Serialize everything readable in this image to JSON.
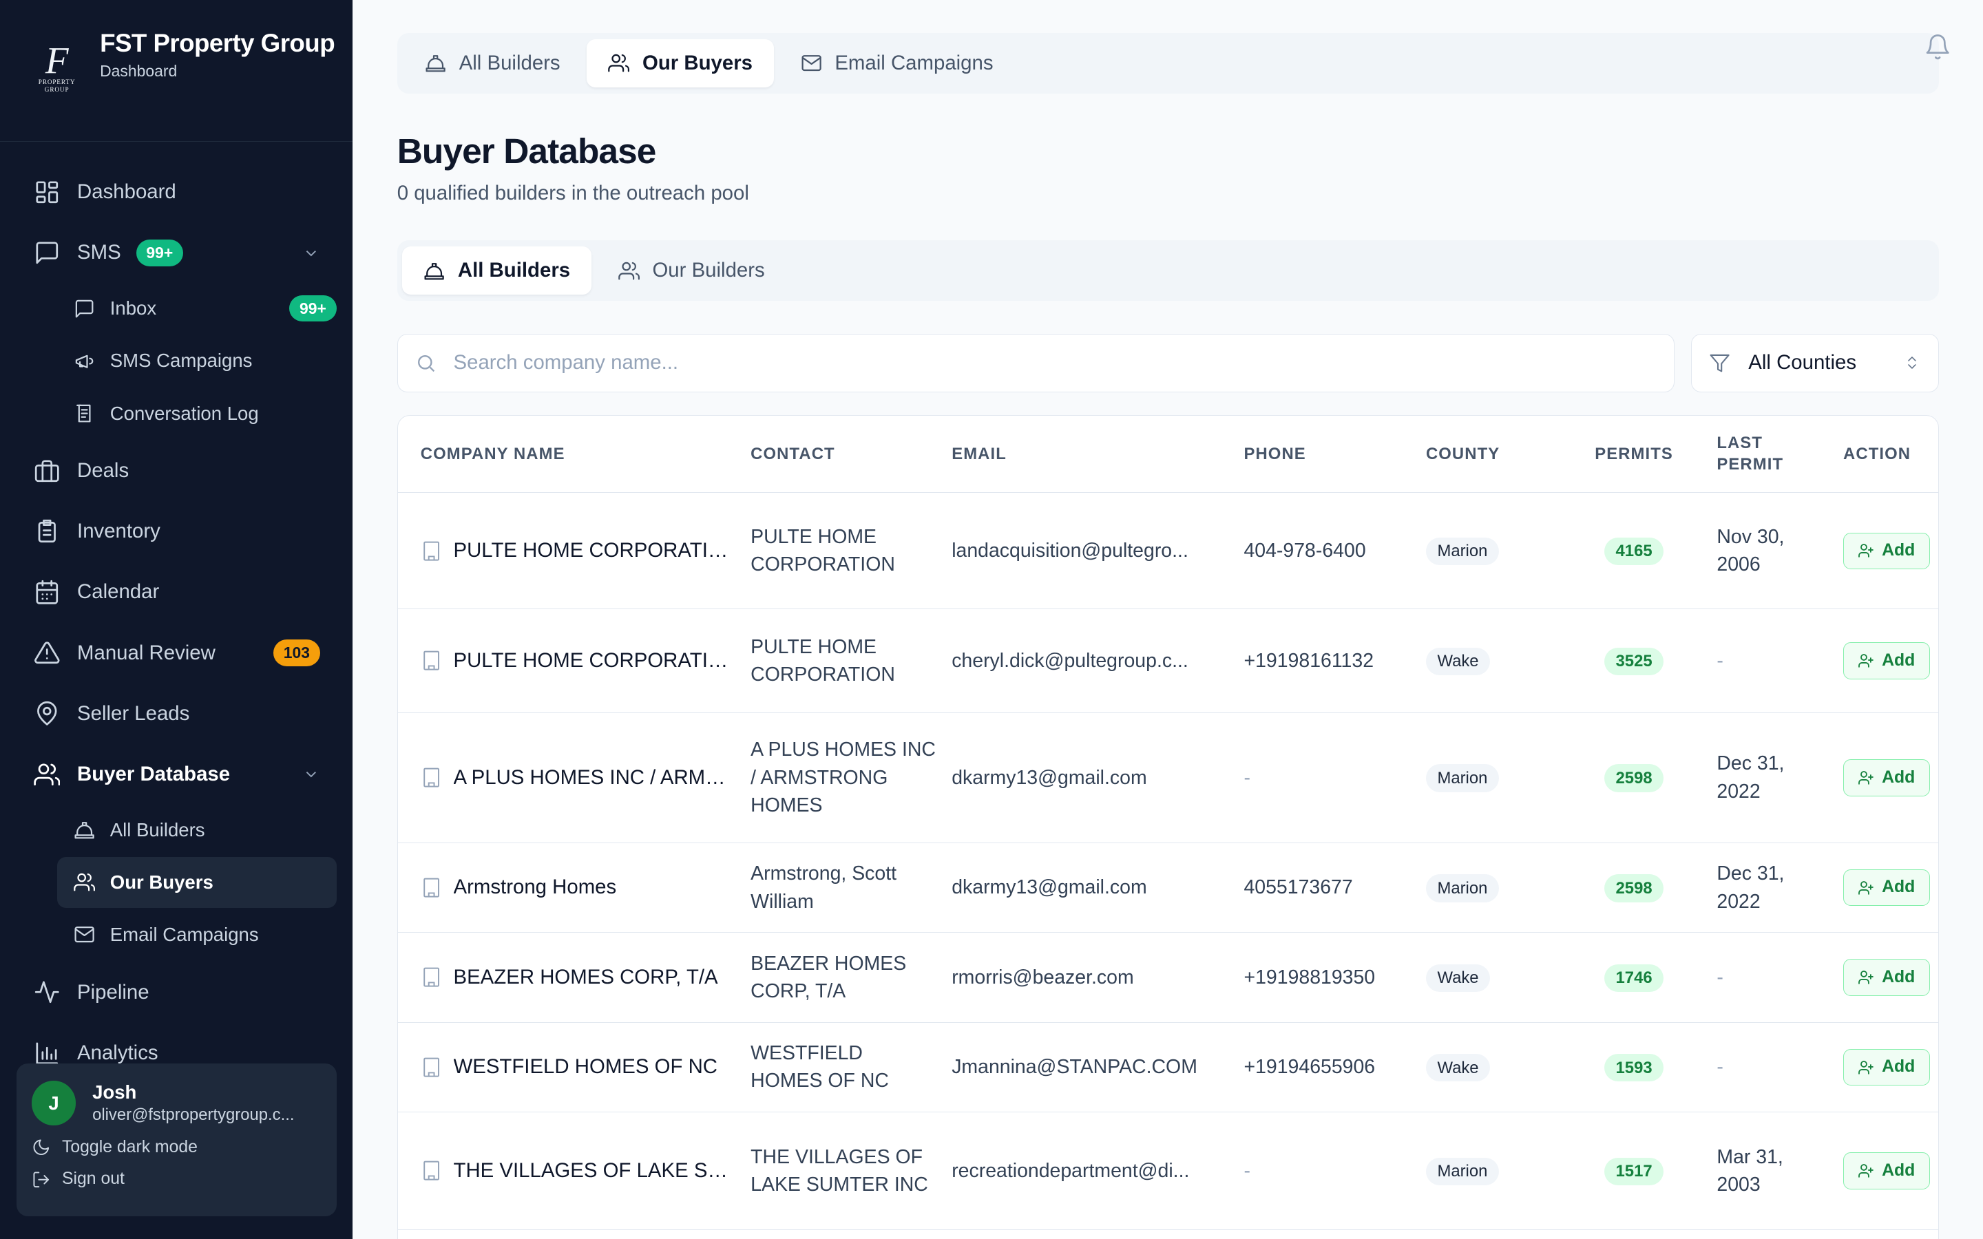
{
  "brand": {
    "logo_text": "F",
    "logo_small": "PROPERTY GROUP",
    "name": "FST Property Group",
    "subtitle": "Dashboard"
  },
  "sidebar": {
    "items": [
      {
        "label": "Dashboard",
        "icon": "dashboard-icon"
      },
      {
        "label": "SMS",
        "icon": "message-square-icon",
        "badge": "99+"
      },
      {
        "label": "Deals",
        "icon": "briefcase-icon"
      },
      {
        "label": "Inventory",
        "icon": "clipboard-icon"
      },
      {
        "label": "Calendar",
        "icon": "calendar-icon"
      },
      {
        "label": "Manual Review",
        "icon": "alert-triangle-icon",
        "badge": "103"
      },
      {
        "label": "Seller Leads",
        "icon": "map-pin-icon"
      },
      {
        "label": "Buyer Database",
        "icon": "users-icon"
      },
      {
        "label": "Pipeline",
        "icon": "activity-icon"
      },
      {
        "label": "Analytics",
        "icon": "bar-chart-icon"
      }
    ],
    "sms_sub": [
      {
        "label": "Inbox",
        "icon": "message-icon",
        "badge": "99+"
      },
      {
        "label": "SMS Campaigns",
        "icon": "megaphone-icon"
      },
      {
        "label": "Conversation Log",
        "icon": "log-icon"
      }
    ],
    "buyer_sub": [
      {
        "label": "All Builders",
        "icon": "hard-hat-icon"
      },
      {
        "label": "Our Buyers",
        "icon": "users-icon"
      },
      {
        "label": "Email Campaigns",
        "icon": "mail-icon"
      }
    ]
  },
  "user": {
    "avatar": "J",
    "name": "Josh",
    "email": "oliver@fstpropertygroup.c...",
    "toggle_dark": "Toggle dark mode",
    "sign_out": "Sign out"
  },
  "top_tabs": [
    {
      "label": "All Builders"
    },
    {
      "label": "Our Buyers"
    },
    {
      "label": "Email Campaigns"
    }
  ],
  "page": {
    "title": "Buyer Database",
    "subtitle": "0 qualified builders in the outreach pool"
  },
  "inner_tabs": [
    {
      "label": "All Builders"
    },
    {
      "label": "Our Builders"
    }
  ],
  "search": {
    "placeholder": "Search company name..."
  },
  "county_filter": {
    "selected": "All Counties"
  },
  "table": {
    "headers": {
      "company": "COMPANY NAME",
      "contact": "CONTACT",
      "email": "EMAIL",
      "phone": "PHONE",
      "county": "COUNTY",
      "permits": "PERMITS",
      "last_permit": "LAST PERMIT",
      "action": "ACTION"
    },
    "rows": [
      {
        "company": "PULTE HOME CORPORATION",
        "contact": "PULTE HOME CORPORATION",
        "email": "landacquisition@pultegro...",
        "phone": "404-978-6400",
        "county": "Marion",
        "permits": "4165",
        "last_permit": "Nov 30, 2006",
        "action": "Add"
      },
      {
        "company": "PULTE HOME CORPORATION",
        "contact": "PULTE HOME CORPORATION",
        "email": "cheryl.dick@pultegroup.c...",
        "phone": "+19198161132",
        "county": "Wake",
        "permits": "3525",
        "last_permit": "-",
        "action": "Add"
      },
      {
        "company": "A PLUS HOMES INC / ARMS...",
        "contact": "A PLUS HOMES INC / ARMSTRONG HOMES",
        "email": "dkarmy13@gmail.com",
        "phone": "-",
        "county": "Marion",
        "permits": "2598",
        "last_permit": "Dec 31, 2022",
        "action": "Add"
      },
      {
        "company": "Armstrong Homes",
        "contact": "Armstrong, Scott William",
        "email": "dkarmy13@gmail.com",
        "phone": "4055173677",
        "county": "Marion",
        "permits": "2598",
        "last_permit": "Dec 31, 2022",
        "action": "Add"
      },
      {
        "company": "BEAZER HOMES CORP, T/A",
        "contact": "BEAZER HOMES CORP, T/A",
        "email": "rmorris@beazer.com",
        "phone": "+19198819350",
        "county": "Wake",
        "permits": "1746",
        "last_permit": "-",
        "action": "Add"
      },
      {
        "company": "WESTFIELD HOMES OF NC",
        "contact": "WESTFIELD HOMES OF NC",
        "email": "Jmannina@STANPAC.COM",
        "phone": "+19194655906",
        "county": "Wake",
        "permits": "1593",
        "last_permit": "-",
        "action": "Add"
      },
      {
        "company": "THE VILLAGES OF LAKE SU...",
        "contact": "THE VILLAGES OF LAKE SUMTER INC",
        "email": "recreationdepartment@di...",
        "phone": "-",
        "county": "Marion",
        "permits": "1517",
        "last_permit": "Mar 31, 2003",
        "action": "Add"
      }
    ]
  },
  "colors": {
    "sidebar_bg": "#0f172a",
    "accent_green": "#10b981",
    "badge_orange": "#f59e0b",
    "permit_pill_bg": "#dcfce7",
    "permit_pill_text": "#15803d"
  }
}
